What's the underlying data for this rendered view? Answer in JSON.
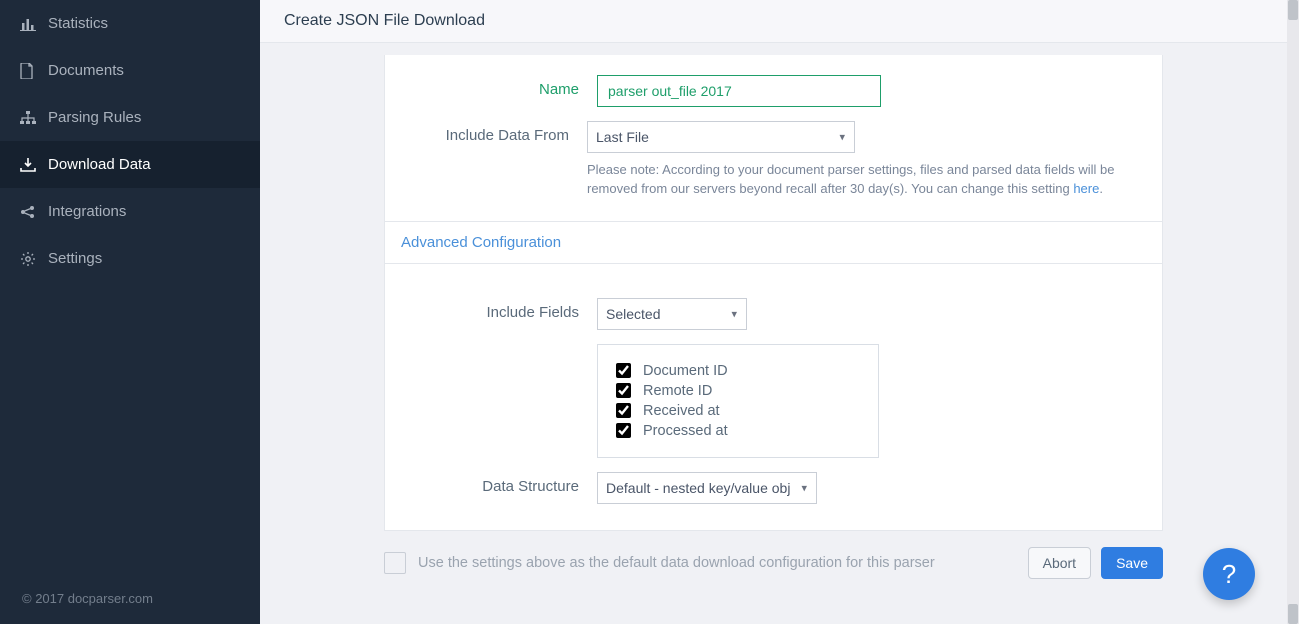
{
  "sidebar": {
    "items": [
      {
        "label": "Statistics"
      },
      {
        "label": "Documents"
      },
      {
        "label": "Parsing Rules"
      },
      {
        "label": "Download Data"
      },
      {
        "label": "Integrations"
      },
      {
        "label": "Settings"
      }
    ],
    "footer": "© 2017 docparser.com"
  },
  "header": {
    "title": "Create JSON File Download"
  },
  "form": {
    "name_label": "Name",
    "name_value": "parser out_file 2017",
    "include_from_label": "Include Data From",
    "include_from_value": "Last File",
    "note_prefix": "Please note: According to your document parser settings, files and parsed data fields will be removed from our servers beyond recall after 30 day(s). You can change this setting ",
    "note_link": "here",
    "note_suffix": ".",
    "advanced_title": "Advanced Configuration",
    "include_fields_label": "Include Fields",
    "include_fields_value": "Selected",
    "fields": [
      {
        "label": "Document ID",
        "checked": true
      },
      {
        "label": "Remote ID",
        "checked": true
      },
      {
        "label": "Received at",
        "checked": true
      },
      {
        "label": "Processed at",
        "checked": true
      }
    ],
    "data_structure_label": "Data Structure",
    "data_structure_value": "Default - nested key/value obj"
  },
  "footer": {
    "default_label": "Use the settings above as the default data download configuration for this parser",
    "abort": "Abort",
    "save": "Save"
  },
  "help_fab": "?"
}
